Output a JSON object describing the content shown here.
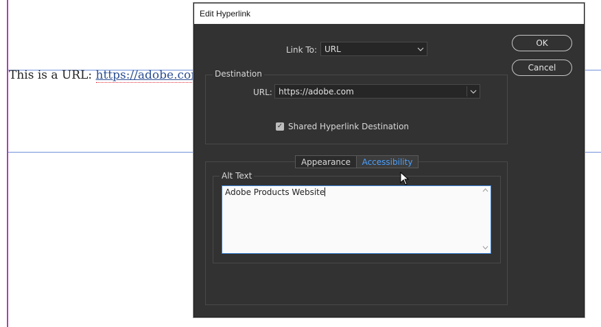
{
  "document": {
    "text_prefix": "This is a URL: ",
    "link_text": "https://adobe.com"
  },
  "dialog": {
    "title": "Edit Hyperlink",
    "link_to": {
      "label": "Link To:",
      "value": "URL"
    },
    "buttons": {
      "ok": "OK",
      "cancel": "Cancel"
    },
    "destination": {
      "group_title": "Destination",
      "url_label": "URL:",
      "url_value": "https://adobe.com",
      "shared_checkbox_label": "Shared Hyperlink Destination",
      "shared_checked": true
    },
    "tabs": [
      {
        "label": "Appearance",
        "active": false
      },
      {
        "label": "Accessibility",
        "active": true
      }
    ],
    "alt_text": {
      "group_title": "Alt Text",
      "value": "Adobe Products Website"
    }
  },
  "colors": {
    "dialog_bg": "#323232",
    "accent": "#4aa0ff",
    "margin_line": "#b13ab5",
    "guide_line": "#6f8fd8"
  }
}
